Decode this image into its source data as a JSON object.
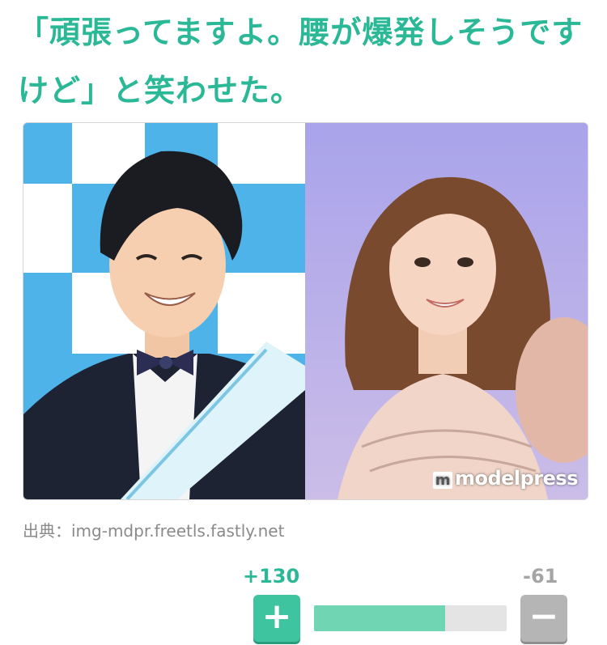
{
  "headline": {
    "text": "「頑張ってますよ。腰が爆発しそうですけど」と笑わせた。"
  },
  "image": {
    "watermark_mark": "m",
    "watermark_text": "modelpress"
  },
  "source": {
    "text": "出典：img-mdpr.freetls.fastly.net"
  },
  "vote": {
    "plus_count": "+130",
    "minus_count": "-61",
    "plus_glyph": "+",
    "minus_glyph": "−",
    "plus_ratio": 0.68,
    "colors": {
      "accent": "#2bb896",
      "bar_fill": "#6fd5b2",
      "minus": "#b5b5b5"
    }
  }
}
